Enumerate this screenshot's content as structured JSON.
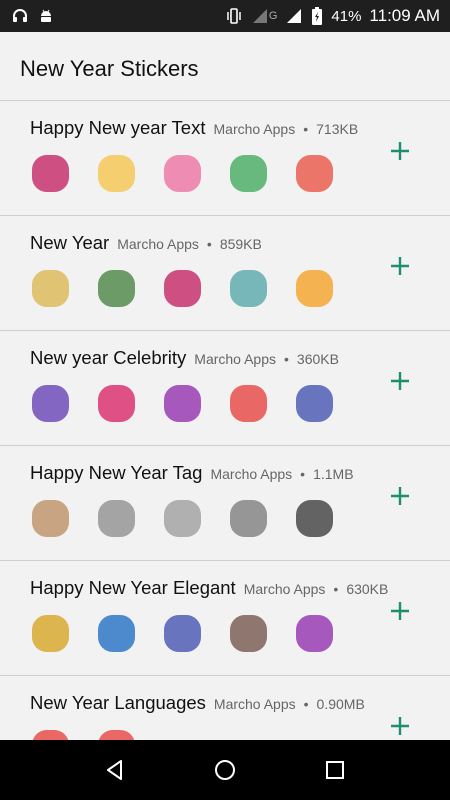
{
  "status_bar": {
    "time": "11:09 AM",
    "battery": "41%",
    "network_label": "G",
    "icons": [
      "headset-icon",
      "android-icon",
      "vibrate-icon",
      "signal-icon",
      "signal-icon",
      "battery-charging-icon"
    ]
  },
  "header": {
    "title": "New Year Stickers"
  },
  "colors": {
    "accent": "#1e8e6e",
    "divider": "#cfcfcf",
    "background": "#f2f2f2"
  },
  "packs": [
    {
      "name": "Happy New year Text",
      "author": "Marcho Apps",
      "size": "713KB",
      "stickers": [
        {
          "icon": "party-hat-sticker",
          "color": "#c2185b"
        },
        {
          "icon": "party-hat-sticker",
          "color": "#f6c343"
        },
        {
          "icon": "gift-sticker",
          "color": "#ec6a9e"
        },
        {
          "icon": "happy-new-year-sticker",
          "color": "#3aa655"
        },
        {
          "icon": "balloons-sticker",
          "color": "#e94b3c"
        }
      ]
    },
    {
      "name": "New Year",
      "author": "Marcho Apps",
      "size": "859KB",
      "stickers": [
        {
          "icon": "champagne-glasses-sticker",
          "color": "#d9b44a"
        },
        {
          "icon": "champagne-bottle-sticker",
          "color": "#3f7d3a"
        },
        {
          "icon": "happy-new-year-sticker",
          "color": "#c2185b"
        },
        {
          "icon": "happy-new-year-sticker",
          "color": "#4fa3a5"
        },
        {
          "icon": "fireworks-sticker",
          "color": "#f59c1a"
        }
      ]
    },
    {
      "name": "New year Celebrity",
      "author": "Marcho Apps",
      "size": "360KB",
      "stickers": [
        {
          "icon": "celebrity-sticker",
          "color": "#5e35b1"
        },
        {
          "icon": "celebrity-sticker",
          "color": "#d81b60"
        },
        {
          "icon": "celebrity-sticker",
          "color": "#8e24aa"
        },
        {
          "icon": "celebrity-sticker",
          "color": "#e53935"
        },
        {
          "icon": "celebrity-sticker",
          "color": "#3949ab"
        }
      ]
    },
    {
      "name": "Happy New Year Tag",
      "author": "Marcho Apps",
      "size": "1.1MB",
      "stickers": [
        {
          "icon": "ribbon-tag-sticker",
          "color": "#b98a5e"
        },
        {
          "icon": "ribbon-tag-sticker",
          "color": "#8a8a8a"
        },
        {
          "icon": "ribbon-tag-sticker",
          "color": "#9a9a9a"
        },
        {
          "icon": "ribbon-tag-sticker",
          "color": "#777777"
        },
        {
          "icon": "burst-sticker",
          "color": "#333333"
        }
      ]
    },
    {
      "name": "Happy New Year Elegant",
      "author": "Marcho Apps",
      "size": "630KB",
      "stickers": [
        {
          "icon": "elegant-text-sticker",
          "color": "#d4a017"
        },
        {
          "icon": "elegant-text-sticker",
          "color": "#1565c0"
        },
        {
          "icon": "elegant-text-sticker",
          "color": "#3949ab"
        },
        {
          "icon": "elegant-text-sticker",
          "color": "#6d4c41"
        },
        {
          "icon": "elegant-text-sticker",
          "color": "#8e24aa"
        }
      ]
    },
    {
      "name": "New Year Languages",
      "author": "Marcho Apps",
      "size": "0.90MB",
      "stickers": [
        {
          "icon": "language-sticker",
          "color": "#e53935"
        },
        {
          "icon": "language-sticker",
          "color": "#e53935"
        }
      ]
    }
  ],
  "nav": {
    "icons": [
      "back-icon",
      "home-icon",
      "recents-icon"
    ]
  }
}
